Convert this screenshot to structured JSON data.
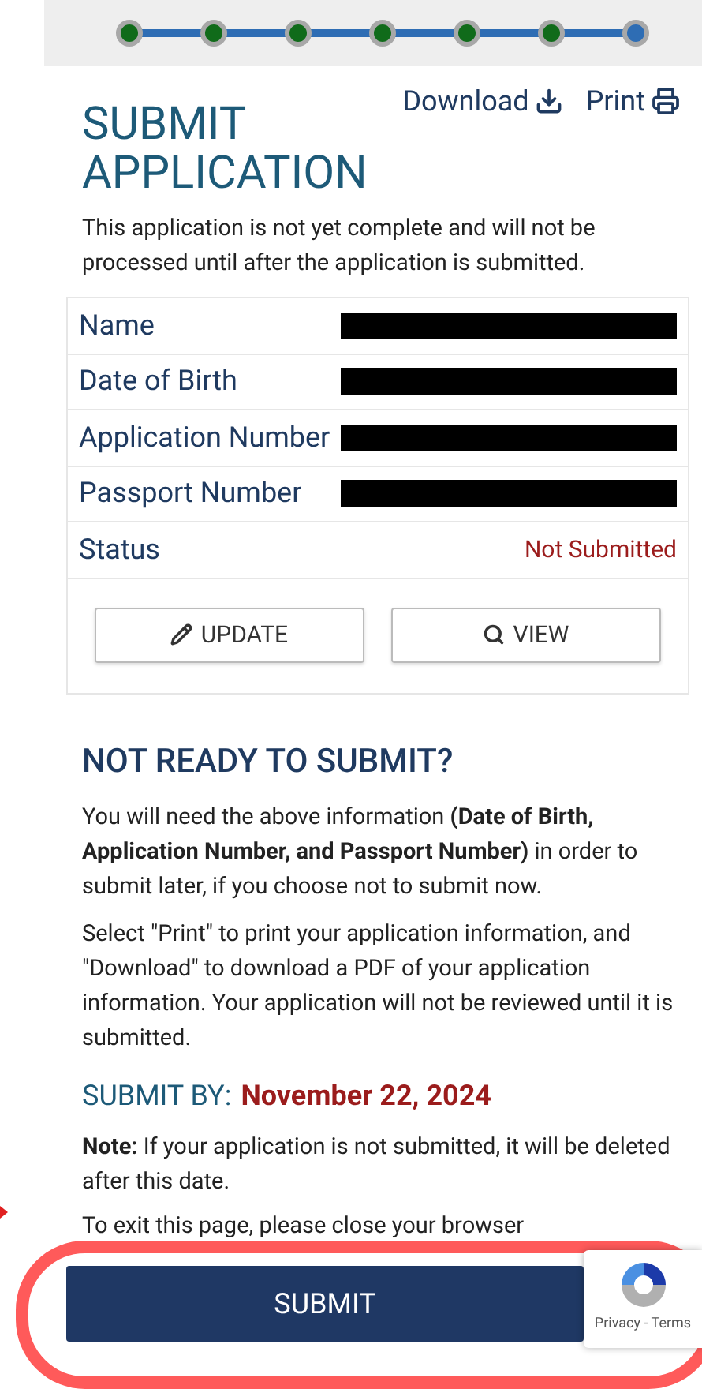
{
  "progress": {
    "steps": [
      {
        "completed": true
      },
      {
        "completed": true
      },
      {
        "completed": true
      },
      {
        "completed": true
      },
      {
        "completed": true
      },
      {
        "completed": true
      },
      {
        "completed": false
      }
    ]
  },
  "actions": [
    {
      "kind": "download",
      "label": "Download"
    },
    {
      "kind": "print",
      "label": "Print"
    }
  ],
  "title": "SUBMIT APPLICATION",
  "intro": "This application is not yet complete and will not be processed until after the application is submitted.",
  "details": [
    {
      "label": "Name",
      "redacted": true
    },
    {
      "label": "Date of Birth",
      "redacted": true
    },
    {
      "label": "Application Number",
      "redacted": true
    },
    {
      "label": "Passport Number",
      "redacted": true
    },
    {
      "label": "Status",
      "redacted": false,
      "value": "Not Submitted"
    }
  ],
  "buttons": [
    {
      "kind": "update",
      "label": "UPDATE"
    },
    {
      "kind": "view",
      "label": "VIEW"
    }
  ],
  "not_ready": {
    "heading": "NOT READY TO SUBMIT?",
    "paragraphs": [
      "You will need the above information **(Date of Birth, Application Number, and Passport Number)** in order to submit later, if you choose not to submit now.",
      "Select \"Print\" to print your application information, and \"Download\" to download a PDF of your application information. Your application will not be reviewed until it is submitted."
    ]
  },
  "submit_by": {
    "label": "SUBMIT BY:",
    "date": "November 22, 2024"
  },
  "note": "**Note:** If your application is not submitted, it will be deleted after this date.",
  "exit_text": "To exit this page, please close your browser",
  "submit_button": "SUBMIT",
  "recaptcha": {
    "links": "Privacy - Terms"
  }
}
